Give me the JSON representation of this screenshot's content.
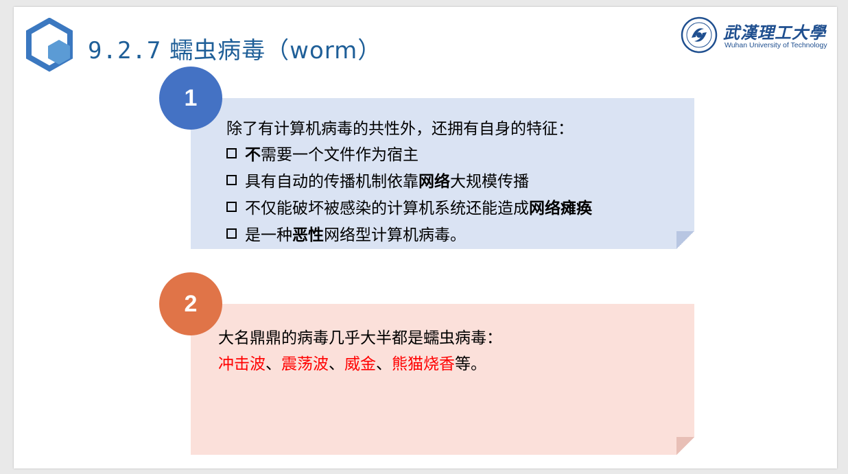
{
  "header": {
    "title_num": "9.2.7",
    "title_text": "蠕虫病毒（worm）",
    "logo_icon": "hexagon-logo-icon"
  },
  "university": {
    "name_cn": "武漢理工大學",
    "name_en": "Wuhan University of Technology",
    "emblem_icon": "university-emblem-icon"
  },
  "card1": {
    "badge": "1",
    "intro": "除了有计算机病毒的共性外，还拥有自身的特征：",
    "items": [
      {
        "b1": "不",
        "t1": "需要一个文件作为宿主"
      },
      {
        "t1": "具有自动的传播机制依靠",
        "b1": "网络",
        "t2": "大规模传播"
      },
      {
        "t1": "不仅能破坏被感染的计算机系统还能造成",
        "b1": "网络瘫痪"
      },
      {
        "t1": "是一种",
        "b1": "恶性",
        "t2": "网络型计算机病毒。"
      }
    ]
  },
  "card2": {
    "badge": "2",
    "intro": "大名鼎鼎的病毒几乎大半都是蠕虫病毒：",
    "examples": [
      "冲击波",
      "震荡波",
      "威金",
      "熊猫烧香"
    ],
    "sep": "、",
    "tail": "等。"
  },
  "colors": {
    "title": "#1f5f98",
    "card1_bg": "#dae3f3",
    "card2_bg": "#fbe0da",
    "badge1": "#4472c4",
    "badge2": "#e07448",
    "highlight": "#ff0000"
  }
}
